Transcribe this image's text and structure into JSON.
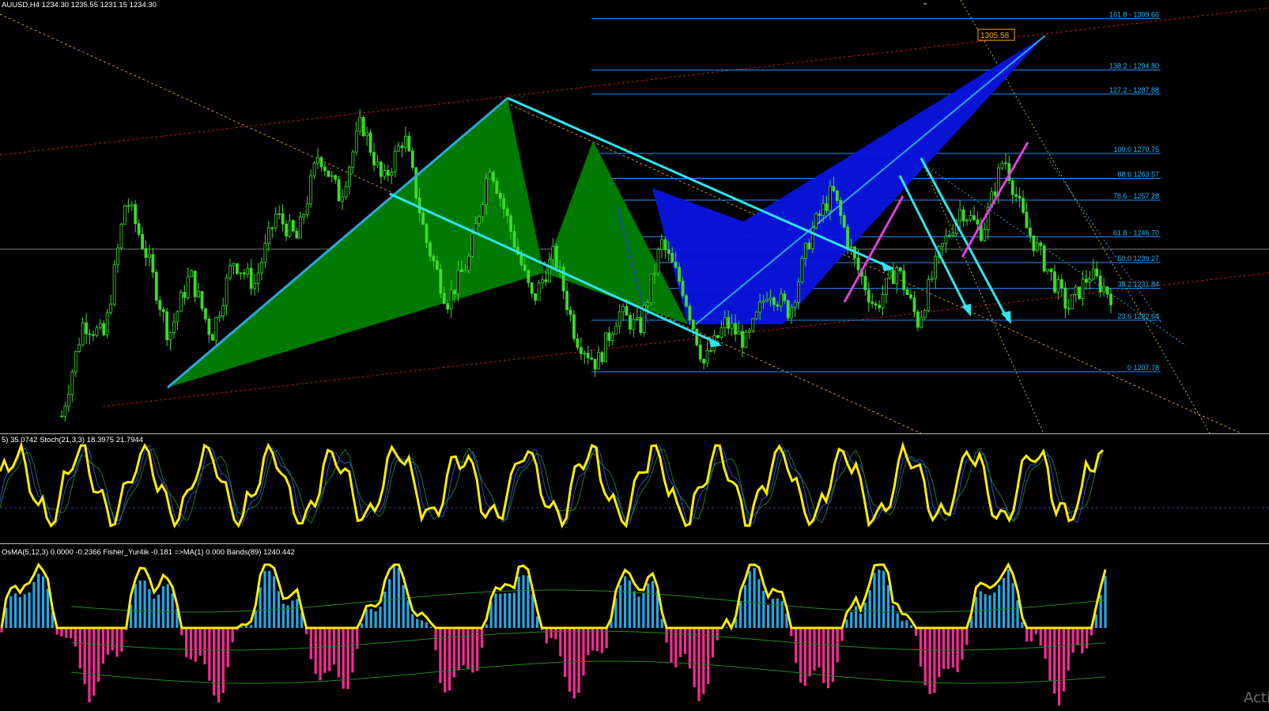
{
  "window": {
    "main_title": "AUUSD,H4  1234.30 1235.55 1231.15 1234.30",
    "stoch_title": "5) 35.0742  Stoch(21,3,3) 18.3975 21.7944",
    "osma_title": "OsMA(5,12,3) 0.0000 -0.2366  Fisher_Yur4ik -0.181  =>MA(1) 0.000  Bands(89) 1240.442",
    "price_tag": "1305.58",
    "watermark": "Acti"
  },
  "colors": {
    "background": "#000000",
    "candles": "#3adc2a",
    "green_pattern": "#007a00",
    "blue_pattern": "#0a14e0",
    "cyan": "#2ee6f0",
    "magenta": "#e040e0",
    "fib_line": "#1e90ff",
    "red_dotted": "#c01818",
    "orange_dotted": "#c89628",
    "stoch_main": "#ffee00",
    "histogram_pos": "#22a8e8",
    "histogram_neg": "#ff2a9a",
    "bands": "#1f8a1f"
  },
  "chart_data": [
    {
      "type": "candlestick",
      "symbol": "AUUSD,H4",
      "ylim": [
        1190,
        1315
      ],
      "fibonacci_levels": [
        {
          "label": "161.8 - 1309.66",
          "price": 1309.66
        },
        {
          "label": "138.2 - 1294.80",
          "price": 1294.8
        },
        {
          "label": "127.2 - 1287.88",
          "price": 1287.88
        },
        {
          "label": "100.0 1270.75",
          "price": 1270.75
        },
        {
          "label": "88.6 1263.57",
          "price": 1263.57
        },
        {
          "label": "78.6 - 1257.28",
          "price": 1257.28
        },
        {
          "label": "61.8 - 1246.70",
          "price": 1246.7
        },
        {
          "label": "50.0 1239.27",
          "price": 1239.27
        },
        {
          "label": "38.2 1231.84",
          "price": 1231.84
        },
        {
          "label": "23.6 1222.64",
          "price": 1222.64
        },
        {
          "label": "0 1207.78",
          "price": 1207.78
        }
      ],
      "current_price": 1234.3,
      "marked_price": 1305.58,
      "close_path": [
        1195,
        1222,
        1218,
        1258,
        1241,
        1218,
        1236,
        1218,
        1240,
        1233,
        1253,
        1246,
        1271,
        1258,
        1280,
        1262,
        1276,
        1246,
        1228,
        1240,
        1268,
        1248,
        1228,
        1242,
        1218,
        1210,
        1225,
        1220,
        1245,
        1232,
        1210,
        1222,
        1216,
        1232,
        1225,
        1248,
        1260,
        1240,
        1226,
        1238,
        1222,
        1242,
        1255,
        1248,
        1270,
        1250,
        1238,
        1226,
        1236,
        1230
      ]
    },
    {
      "type": "line",
      "indicator": "Stoch(21,3,3)",
      "main": 18.3975,
      "signal": 21.7944,
      "ylim": [
        0,
        100
      ]
    },
    {
      "type": "bar",
      "indicator": "OsMA(5,12,3) / Fisher_Yur4ik / Bands(89)",
      "osma": 0.0,
      "signal": -0.2366,
      "fisher": -0.181,
      "ma": 0.0,
      "bands": 1240.442
    }
  ]
}
